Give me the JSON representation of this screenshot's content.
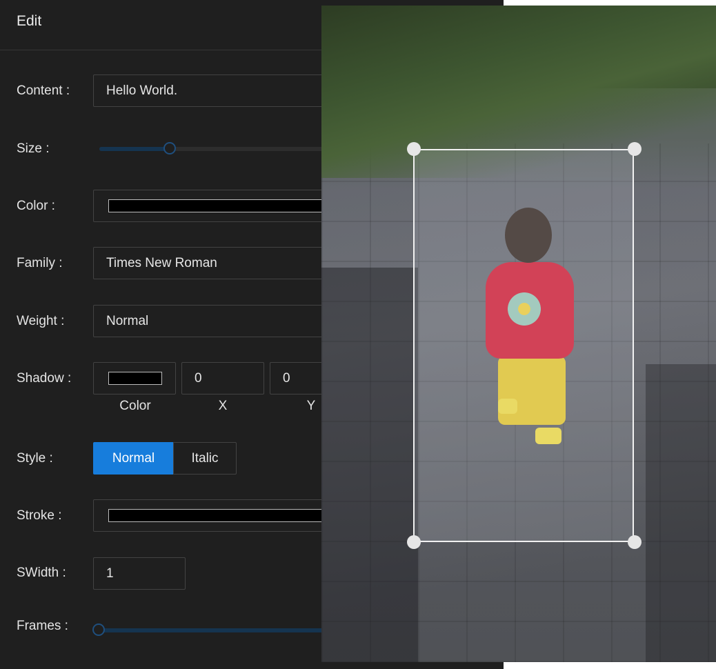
{
  "header": {
    "title": "Edit"
  },
  "form": {
    "content": {
      "label": "Content",
      "value": "Hello World."
    },
    "size": {
      "label": "Size",
      "value_fraction": 0.31
    },
    "color": {
      "label": "Color",
      "value": "#000000"
    },
    "family": {
      "label": "Family",
      "value": "Times New Roman"
    },
    "weight": {
      "label": "Weight",
      "value": "Normal"
    },
    "shadow": {
      "label": "Shadow",
      "color_value": "#000000",
      "x_value": "0",
      "y_value": "0",
      "color_caption": "Color",
      "x_caption": "X",
      "y_caption": "Y"
    },
    "style": {
      "label": "Style",
      "options": [
        "Normal",
        "Italic"
      ],
      "selected": "Normal"
    },
    "stroke": {
      "label": "Stroke",
      "value": "#000000"
    },
    "swidth": {
      "label": "SWidth",
      "value": "1"
    },
    "frames": {
      "label": "Frames",
      "value_fraction": 0.0
    }
  },
  "colors": {
    "accent": "#177ddc",
    "panel_bg": "#1f1f1f",
    "border": "#434343"
  }
}
